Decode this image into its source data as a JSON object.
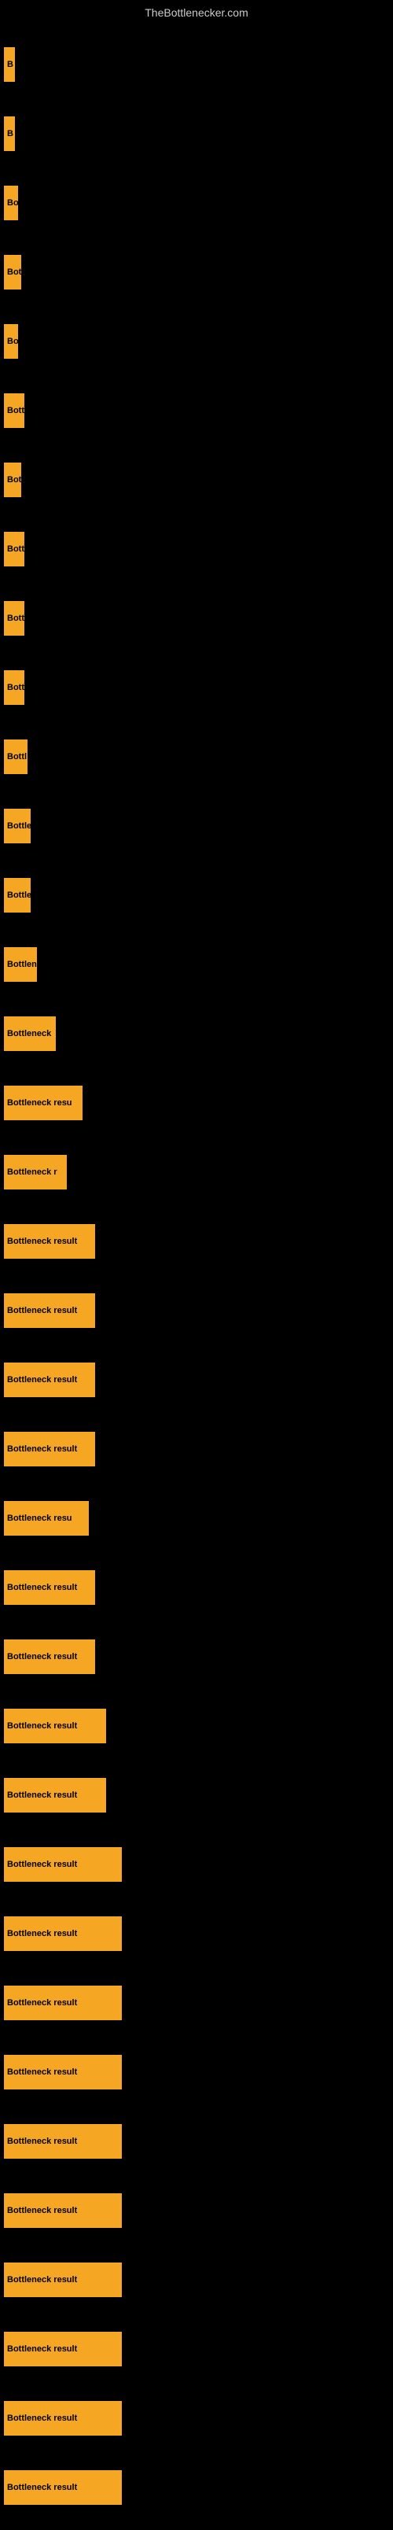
{
  "site_title": "TheBottlenecker.com",
  "bars": [
    {
      "label": "B",
      "width": 14
    },
    {
      "label": "B",
      "width": 14
    },
    {
      "label": "Bo",
      "width": 18
    },
    {
      "label": "Bot",
      "width": 22
    },
    {
      "label": "Bo",
      "width": 18
    },
    {
      "label": "Bott",
      "width": 26
    },
    {
      "label": "Bot",
      "width": 22
    },
    {
      "label": "Bott",
      "width": 26
    },
    {
      "label": "Bott",
      "width": 26
    },
    {
      "label": "Bott",
      "width": 26
    },
    {
      "label": "Bottl",
      "width": 30
    },
    {
      "label": "Bottle",
      "width": 34
    },
    {
      "label": "Bottle",
      "width": 34
    },
    {
      "label": "Bottlen",
      "width": 42
    },
    {
      "label": "Bottleneck",
      "width": 66
    },
    {
      "label": "Bottleneck resu",
      "width": 100
    },
    {
      "label": "Bottleneck r",
      "width": 80
    },
    {
      "label": "Bottleneck result",
      "width": 116
    },
    {
      "label": "Bottleneck result",
      "width": 116
    },
    {
      "label": "Bottleneck result",
      "width": 116
    },
    {
      "label": "Bottleneck result",
      "width": 116
    },
    {
      "label": "Bottleneck resu",
      "width": 108
    },
    {
      "label": "Bottleneck result",
      "width": 116
    },
    {
      "label": "Bottleneck result",
      "width": 116
    },
    {
      "label": "Bottleneck result",
      "width": 130
    },
    {
      "label": "Bottleneck result",
      "width": 130
    },
    {
      "label": "Bottleneck result",
      "width": 150
    },
    {
      "label": "Bottleneck result",
      "width": 150
    },
    {
      "label": "Bottleneck result",
      "width": 150
    },
    {
      "label": "Bottleneck result",
      "width": 150
    },
    {
      "label": "Bottleneck result",
      "width": 150
    },
    {
      "label": "Bottleneck result",
      "width": 150
    },
    {
      "label": "Bottleneck result",
      "width": 150
    },
    {
      "label": "Bottleneck result",
      "width": 150
    },
    {
      "label": "Bottleneck result",
      "width": 150
    },
    {
      "label": "Bottleneck result",
      "width": 150
    }
  ]
}
